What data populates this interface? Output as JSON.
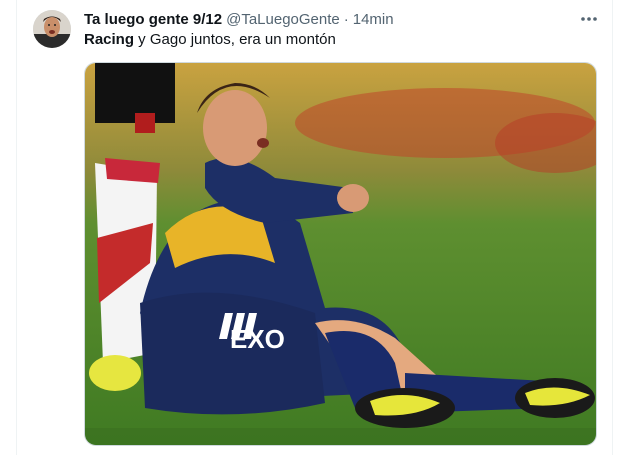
{
  "tweet": {
    "author": {
      "display_name": "Ta luego gente 9/12",
      "handle": "@TaLuegoGente",
      "separator": "·",
      "timestamp": "14min"
    },
    "text_bold": "Racing",
    "text_rest": " y Gago juntos, era un montón",
    "more_icon": "more-horizontal-icon",
    "media_description": "photo"
  },
  "colors": {
    "text_primary": "#0f1419",
    "text_secondary": "#536471",
    "border": "#cfd9de",
    "grass": "#4f8a2a",
    "jersey_blue": "#1d2f66",
    "jersey_yellow": "#e8b428"
  }
}
